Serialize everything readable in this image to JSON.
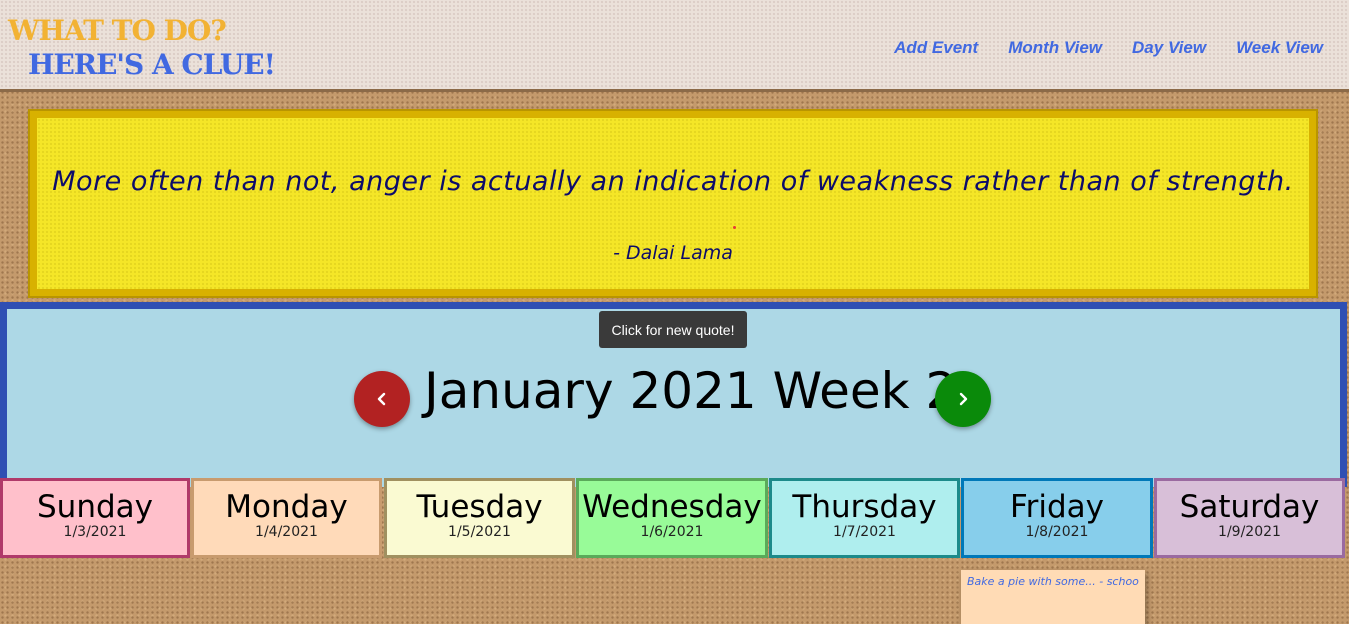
{
  "header": {
    "brand_line1": "WHAT TO DO?",
    "brand_line2": "HERE'S A CLUE!",
    "nav": [
      "Add Event",
      "Month View",
      "Day View",
      "Week View"
    ]
  },
  "quote": {
    "text": "More often than not, anger is actually an indication of weakness rather than of strength.",
    "author": "- Dalai Lama",
    "tooltip": "Click for new quote!"
  },
  "week": {
    "title": "January 2021 Week 2",
    "prev_icon": "chevron-left-icon",
    "next_icon": "chevron-right-icon",
    "days": [
      {
        "name": "Sunday",
        "date": "1/3/2021",
        "bg": "#ffc0cb",
        "border": "#b03a6a"
      },
      {
        "name": "Monday",
        "date": "1/4/2021",
        "bg": "#ffdab9",
        "border": "#c89b6e"
      },
      {
        "name": "Tuesday",
        "date": "1/5/2021",
        "bg": "#fafad2",
        "border": "#a09060"
      },
      {
        "name": "Wednesday",
        "date": "1/6/2021",
        "bg": "#98fb98",
        "border": "#5aaa5a"
      },
      {
        "name": "Thursday",
        "date": "1/7/2021",
        "bg": "#afeeee",
        "border": "#1d8a8a"
      },
      {
        "name": "Friday",
        "date": "1/8/2021",
        "bg": "#87ceeb",
        "border": "#0078b8"
      },
      {
        "name": "Saturday",
        "date": "1/9/2021",
        "bg": "#d8bfd8",
        "border": "#9a6aa0"
      }
    ]
  },
  "events": [
    {
      "text": "Bake a pie with some... - school",
      "day": "Friday"
    }
  ]
}
